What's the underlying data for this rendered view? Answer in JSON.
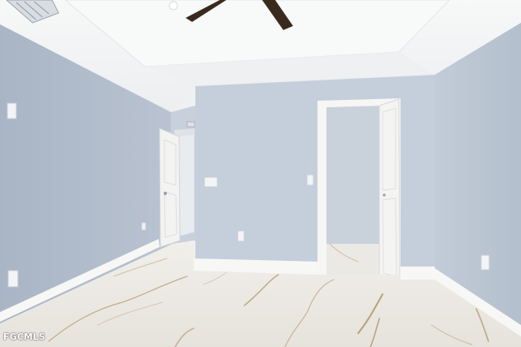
{
  "scene": {
    "description_label": "",
    "colors": {
      "wall_left": "#aeb9c8",
      "wall_back": "#c4cfdc",
      "wall_right": "#b7c2cf",
      "ceiling": "#f4f5f6",
      "floor": "#e9e7e2",
      "trim": "#f7f7f5",
      "door": "#f3f3f2",
      "vein": "#a8885a",
      "fan_blade": "#3a2a1e"
    }
  },
  "watermark": {
    "text": "FGCMLS"
  }
}
